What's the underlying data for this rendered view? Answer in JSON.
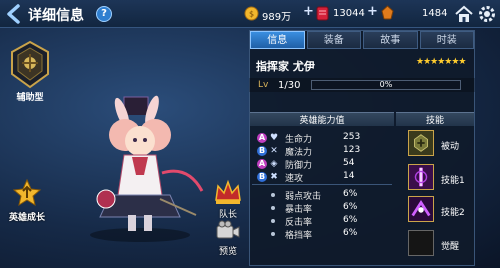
{
  "header": {
    "title": "详细信息",
    "help": "?"
  },
  "resources": {
    "gold": "989万",
    "gems": "13044",
    "stamina": "1484"
  },
  "left": {
    "role": "辅助型",
    "growth": "英雄成长",
    "captain": "队长",
    "preview": "预览"
  },
  "tabs": [
    {
      "label": "信息",
      "active": true
    },
    {
      "label": "装备",
      "active": false
    },
    {
      "label": "故事",
      "active": false
    },
    {
      "label": "时装",
      "active": false
    }
  ],
  "hero": {
    "name": "指挥家 尤伊",
    "stars": "★★★★★★★",
    "level_prefix": "Lv",
    "level": "1/30",
    "exp_text": "0%",
    "exp_fraction": 0
  },
  "stats": {
    "title": "英雄能力值",
    "primary": [
      {
        "grade": "A",
        "icon": "heart-icon",
        "label": "生命力",
        "value": "253"
      },
      {
        "grade": "B",
        "icon": "swords-icon",
        "label": "魔法力",
        "value": "123"
      },
      {
        "grade": "A",
        "icon": "shield-icon",
        "label": "防御力",
        "value": "54"
      },
      {
        "grade": "B",
        "icon": "cross-icon",
        "label": "速攻",
        "value": "14"
      }
    ],
    "secondary": [
      {
        "label": "弱点攻击",
        "value": "6%"
      },
      {
        "label": "暴击率",
        "value": "6%"
      },
      {
        "label": "反击率",
        "value": "6%"
      },
      {
        "label": "格挡率",
        "value": "6%"
      }
    ]
  },
  "skills": {
    "title": "技能",
    "items": [
      {
        "label": "被动"
      },
      {
        "label": "技能1"
      },
      {
        "label": "技能2"
      },
      {
        "label": "觉醒"
      }
    ]
  },
  "colors": {
    "accent": "#2f7fd0",
    "star": "#ffcc2e",
    "exp": "#e2b23a"
  }
}
